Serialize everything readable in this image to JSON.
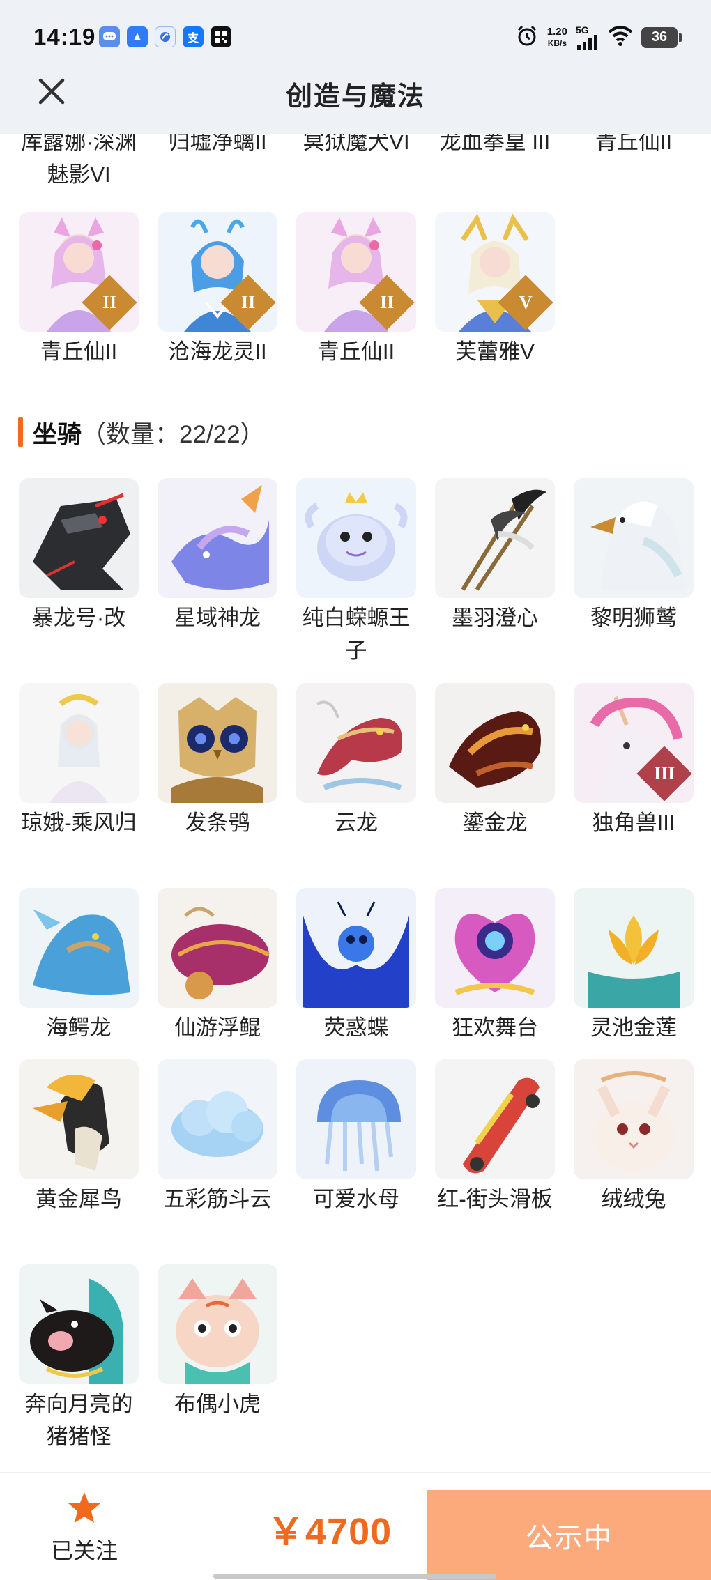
{
  "status_bar": {
    "time": "14:19",
    "net_speed": "1.20",
    "net_unit": "KB/s",
    "network": "5G",
    "battery": "36",
    "notification_icons": [
      "message-app-icon",
      "blue-app-icon",
      "browser-app-icon",
      "alipay-icon",
      "qr-app-icon"
    ],
    "alipay_glyph": "支"
  },
  "header": {
    "title": "创造与魔法",
    "close_icon": "close-icon"
  },
  "top_items": [
    {
      "label": "库露娜·深渊魅影VI"
    },
    {
      "label": "归墟净螭II"
    },
    {
      "label": "冥狱魔犬VI"
    },
    {
      "label": "龙血拳皇 III"
    },
    {
      "label": "青丘仙II"
    }
  ],
  "char_items": [
    {
      "label": "青丘仙II",
      "rank": "II"
    },
    {
      "label": "沧海龙灵II",
      "rank": "II"
    },
    {
      "label": "青丘仙II",
      "rank": "II"
    },
    {
      "label": "芙蕾雅V",
      "rank": "V"
    }
  ],
  "mount_section": {
    "title": "坐骑",
    "count": "（数量：22/22）"
  },
  "mounts": [
    {
      "label": "暴龙号·改"
    },
    {
      "label": "星域神龙"
    },
    {
      "label": "纯白蝾螈王子"
    },
    {
      "label": "墨羽澄心"
    },
    {
      "label": "黎明狮鹫"
    },
    {
      "label": "琼娥-乘风归"
    },
    {
      "label": "发条鸮"
    },
    {
      "label": "云龙"
    },
    {
      "label": "鎏金龙"
    },
    {
      "label": "独角兽III",
      "rank": "III"
    },
    {
      "label": "海鳄龙"
    },
    {
      "label": "仙游浮鲲"
    },
    {
      "label": "荧惑蝶"
    },
    {
      "label": "狂欢舞台"
    },
    {
      "label": "灵池金莲"
    },
    {
      "label": "黄金犀鸟"
    },
    {
      "label": "五彩筋斗云"
    },
    {
      "label": "可爱水母"
    },
    {
      "label": "红-街头滑板"
    },
    {
      "label": "绒绒兔"
    },
    {
      "label": "奔向月亮的猪猪怪"
    },
    {
      "label": "布偶小虎"
    }
  ],
  "bottom_bar": {
    "follow_label": "已关注",
    "follow_icon": "star-icon",
    "price": "￥4700",
    "status_button": "公示中"
  },
  "colors": {
    "accent": "#f06a1d",
    "status_button": "#fcaa7c",
    "header_bg": "#eef2f7"
  }
}
